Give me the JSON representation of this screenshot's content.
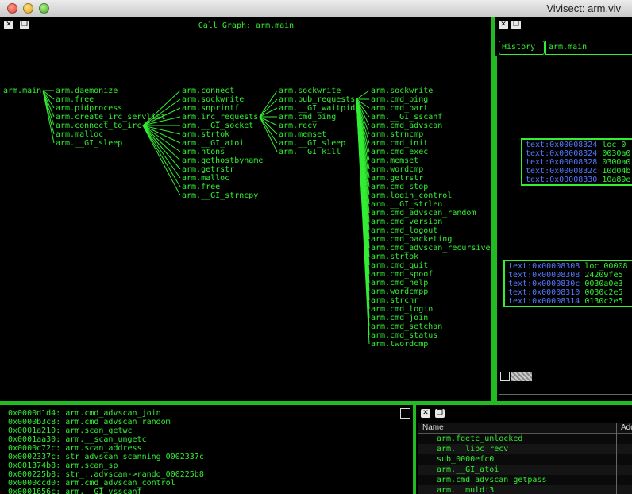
{
  "window": {
    "title": "Vivisect: arm.viv"
  },
  "callgraph": {
    "title": "Call Graph: arm.main",
    "root": "arm.main",
    "col1": [
      "arm.daemonize",
      "arm.free",
      "arm.pidprocess",
      "arm.create_irc_servlist",
      "arm.connect_to_irc",
      "arm.malloc",
      "arm.__GI_sleep"
    ],
    "col2": [
      "arm.connect",
      "arm.sockwrite",
      "arm.snprintf",
      "arm.irc_requests",
      "arm.__GI_socket",
      "arm.strtok",
      "arm.__GI_atoi",
      "arm.htons",
      "arm.gethostbyname",
      "arm.getrstr",
      "arm.malloc",
      "arm.free",
      "arm.__GI_strncpy"
    ],
    "col3": [
      "arm.sockwrite",
      "arm.pub_requests",
      "arm.__GI_waitpid",
      "arm.cmd_ping",
      "arm.recv",
      "arm.memset",
      "arm.__GI_sleep",
      "arm.__GI_kill"
    ],
    "col4": [
      "arm.sockwrite",
      "arm.cmd_ping",
      "arm.cmd_part",
      "arm.__GI_sscanf",
      "arm.cmd_advscan",
      "arm.strncmp",
      "arm.cmd_init",
      "arm.cmd_exec",
      "arm.memset",
      "arm.wordcmp",
      "arm.getrstr",
      "arm.cmd_stop",
      "arm.login_control",
      "arm.__GI_strlen",
      "arm.cmd_advscan_random",
      "arm.cmd_version",
      "arm.cmd_logout",
      "arm.cmd_packeting",
      "arm.cmd_advscan_recursive",
      "arm.strtok",
      "arm.cmd_quit",
      "arm.cmd_spoof",
      "arm.cmd_help",
      "arm.wordcmpp",
      "arm.strchr",
      "arm.cmd_login",
      "arm.cmd_join",
      "arm.cmd_setchan",
      "arm.cmd_status",
      "arm.twordcmp"
    ]
  },
  "history": {
    "button_label": "History",
    "input_value": "arm.main",
    "block1": [
      {
        "addr": "text:0x00008324",
        "val": "loc_0"
      },
      {
        "addr": "text:0x00008324",
        "val": "0030a0"
      },
      {
        "addr": "text:0x00008328",
        "val": "0300a0"
      },
      {
        "addr": "text:0x0000832c",
        "val": "10d04b"
      },
      {
        "addr": "text:0x00008330",
        "val": "10a89e"
      }
    ],
    "block2": [
      {
        "addr": "text:0x00008308",
        "val": "loc_00008"
      },
      {
        "addr": "text:0x00008308",
        "val": "24209fe5"
      },
      {
        "addr": "text:0x0000830c",
        "val": "0030a0e3"
      },
      {
        "addr": "text:0x00008310",
        "val": "0030c2e5"
      },
      {
        "addr": "text:0x00008314",
        "val": "0130c2e5"
      }
    ]
  },
  "console": {
    "lines": [
      "0x0000d1d4: arm.cmd_advscan_join",
      "0x0000b3c8: arm.cmd_advscan_random",
      "0x0001a210: arm.scan_getwc",
      "0x0001aa30: arm.__scan_ungetc",
      "0x0000c72c: arm.scan_address",
      "0x0002337c: str_advscan scanning_0002337c",
      "0x001374b8: arm.scan_sp",
      "0x000225b8: str_..advscan->rando_000225b8",
      "0x0000ccd0: arm.cmd_advscan_control",
      "0x0001656c: arm.__GI_vsscanf"
    ]
  },
  "functions": {
    "col_name": "Name",
    "col_addr": "Add",
    "rows": [
      "arm.fgetc_unlocked",
      "arm.__libc_recv",
      "sub_0000efc0",
      "arm.__GI_atoi",
      "arm.cmd_advscan_getpass",
      "arm.__muldi3"
    ]
  },
  "colors": {
    "accent": "#33ee33",
    "address": "#5577ff",
    "background": "#000000"
  },
  "icons": {
    "close": "close-icon",
    "restore": "restore-icon"
  }
}
